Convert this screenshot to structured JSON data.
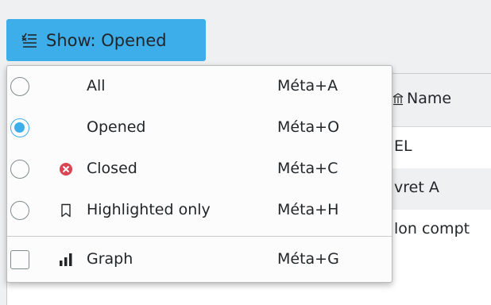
{
  "toolbar": {
    "show_button_label": "Show: Opened",
    "show_button_icon": "filter-list-icon",
    "accent_color": "#3daee9"
  },
  "table": {
    "header": {
      "name_label": "Name",
      "name_icon": "bank-icon"
    },
    "rows": [
      {
        "name": "EL"
      },
      {
        "name": "vret A"
      },
      {
        "name": "lon compt"
      }
    ]
  },
  "menu": {
    "items": [
      {
        "label": "All",
        "shortcut": "Méta+A",
        "type": "radio",
        "checked": false,
        "icon": ""
      },
      {
        "label": "Opened",
        "shortcut": "Méta+O",
        "type": "radio",
        "checked": true,
        "icon": ""
      },
      {
        "label": "Closed",
        "shortcut": "Méta+C",
        "type": "radio",
        "checked": false,
        "icon": "closed-x-icon"
      },
      {
        "label": "Highlighted only",
        "shortcut": "Méta+H",
        "type": "radio",
        "checked": false,
        "icon": "bookmark-icon"
      },
      {
        "label": "Graph",
        "shortcut": "Méta+G",
        "type": "checkbox",
        "checked": false,
        "icon": "bar-chart-icon"
      }
    ]
  }
}
